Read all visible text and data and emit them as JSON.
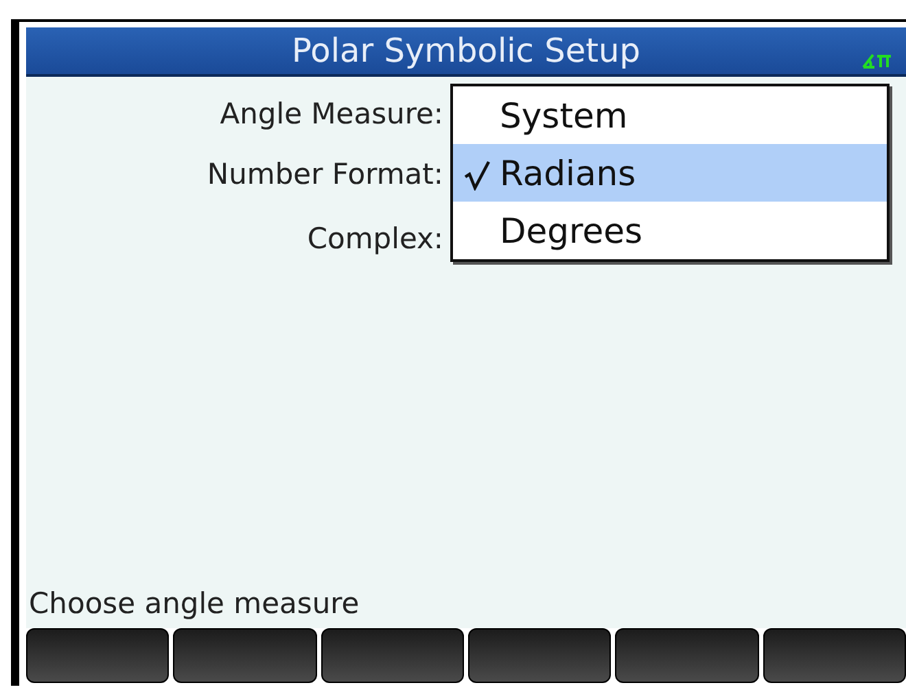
{
  "window": {
    "title": "Polar Symbolic Setup"
  },
  "fields": [
    {
      "label": "Angle Measure:"
    },
    {
      "label": "Number Format:"
    },
    {
      "label": "Complex:"
    }
  ],
  "dropdown": {
    "items": [
      {
        "label": "System",
        "selected": false
      },
      {
        "label": "Radians",
        "selected": true
      },
      {
        "label": "Degrees",
        "selected": false
      }
    ]
  },
  "status_bar": {
    "text": "Choose angle measure"
  }
}
